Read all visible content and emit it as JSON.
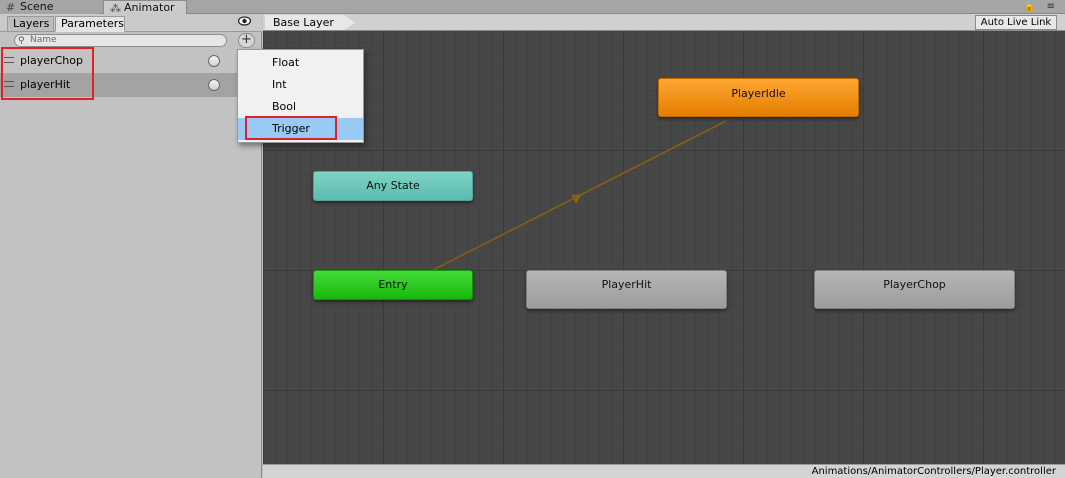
{
  "window_tabs": {
    "scene_label": "Scene",
    "animator_label": "Animator",
    "scene_icon": "grid-icon",
    "animator_icon": "animator-icon",
    "extras": "🔒 ≡"
  },
  "left_panel": {
    "tabs": [
      "Layers",
      "Parameters"
    ],
    "visibility_icon": "eye-icon",
    "search": {
      "placeholder": "Name",
      "icon": "search-icon"
    },
    "add_button": "+",
    "parameters": [
      {
        "name": "playerChop",
        "type": "trigger"
      },
      {
        "name": "playerHit",
        "type": "trigger"
      }
    ]
  },
  "dropdown": {
    "items": [
      "Float",
      "Int",
      "Bool",
      "Trigger"
    ],
    "selected": "Trigger"
  },
  "graph": {
    "breadcrumb": "Base Layer",
    "auto_live_link": "Auto Live Link",
    "nodes": {
      "any_state": "Any State",
      "entry": "Entry",
      "player_idle": "PlayerIdle",
      "player_hit": "PlayerHit",
      "player_chop": "PlayerChop"
    },
    "colors": {
      "default_state": "#ff9f1c",
      "entry": "#2ccb1f",
      "any_state": "#6ccabb",
      "state": "#a9a9a9",
      "transition": "#8a6010"
    }
  },
  "status_bar": {
    "path": "Animations/AnimatorControllers/Player.controller"
  },
  "highlight_color": "#e0212a"
}
